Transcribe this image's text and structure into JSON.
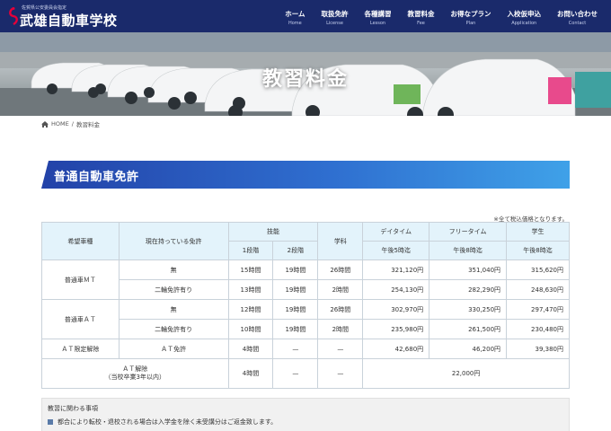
{
  "header": {
    "logo_sub": "佐賀県公安委員会指定",
    "logo_main": "武雄自動車学校",
    "nav": [
      {
        "label": "ホーム",
        "sub": "Home"
      },
      {
        "label": "取扱免許",
        "sub": "License"
      },
      {
        "label": "各種講習",
        "sub": "Lesson"
      },
      {
        "label": "教習料金",
        "sub": "Fee"
      },
      {
        "label": "お得なプラン",
        "sub": "Plan"
      },
      {
        "label": "入校仮申込",
        "sub": "Application"
      },
      {
        "label": "お問い合わせ",
        "sub": "Contact"
      }
    ]
  },
  "hero": {
    "title": "教習料金"
  },
  "breadcrumb": {
    "home": "HOME",
    "sep": "/",
    "current": "教習料金"
  },
  "section": {
    "title": "普通自動車免許"
  },
  "tax_note": "※全て税込価格となります。",
  "table": {
    "head": {
      "desired": "希望車種",
      "current": "現在持っている免許",
      "skill": "技能",
      "stage1": "1段階",
      "stage2": "2段階",
      "academic": "学科",
      "daytime": "デイタイム",
      "daytime_sub": "午後5時迄",
      "freetime": "フリータイム",
      "freetime_sub": "午後8時迄",
      "student": "学生",
      "student_sub": "午後8時迄"
    },
    "rows": {
      "mt_label": "普通車ＭＴ",
      "mt_none": {
        "license": "無",
        "s1": "15時間",
        "s2": "19時間",
        "ac": "26時間",
        "day": "321,120円",
        "free": "351,040円",
        "stu": "315,620円"
      },
      "mt_bike": {
        "license": "二輪免許有り",
        "s1": "13時間",
        "s2": "19時間",
        "ac": "2時間",
        "day": "254,130円",
        "free": "282,290円",
        "stu": "248,630円"
      },
      "at_label": "普通車ＡＴ",
      "at_none": {
        "license": "無",
        "s1": "12時間",
        "s2": "19時間",
        "ac": "26時間",
        "day": "302,970円",
        "free": "330,250円",
        "stu": "297,470円"
      },
      "at_bike": {
        "license": "二輪免許有り",
        "s1": "10時間",
        "s2": "19時間",
        "ac": "2時間",
        "day": "235,980円",
        "free": "261,500円",
        "stu": "230,480円"
      },
      "at_release": {
        "desired": "ＡＴ限定解除",
        "license": "ＡＴ免許",
        "s1": "4時間",
        "s2": "—",
        "ac": "—",
        "day": "42,680円",
        "free": "46,200円",
        "stu": "39,380円"
      },
      "at_release_grad": {
        "desired": "ＡＴ解除",
        "desired_sub": "（当校卒業3年以内）",
        "s1": "4時間",
        "s2": "—",
        "ac": "—",
        "price": "22,000円"
      }
    }
  },
  "notes": {
    "title": "教習に関わる事項",
    "item1": "都合により転校・退校される場合は入学金を除く未受講分はご返金致します。"
  },
  "colors": {
    "header_bg": "#1a2a6b",
    "banner_start": "#2342a8",
    "banner_end": "#3fa1e8",
    "table_head": "#e3f3fb"
  }
}
